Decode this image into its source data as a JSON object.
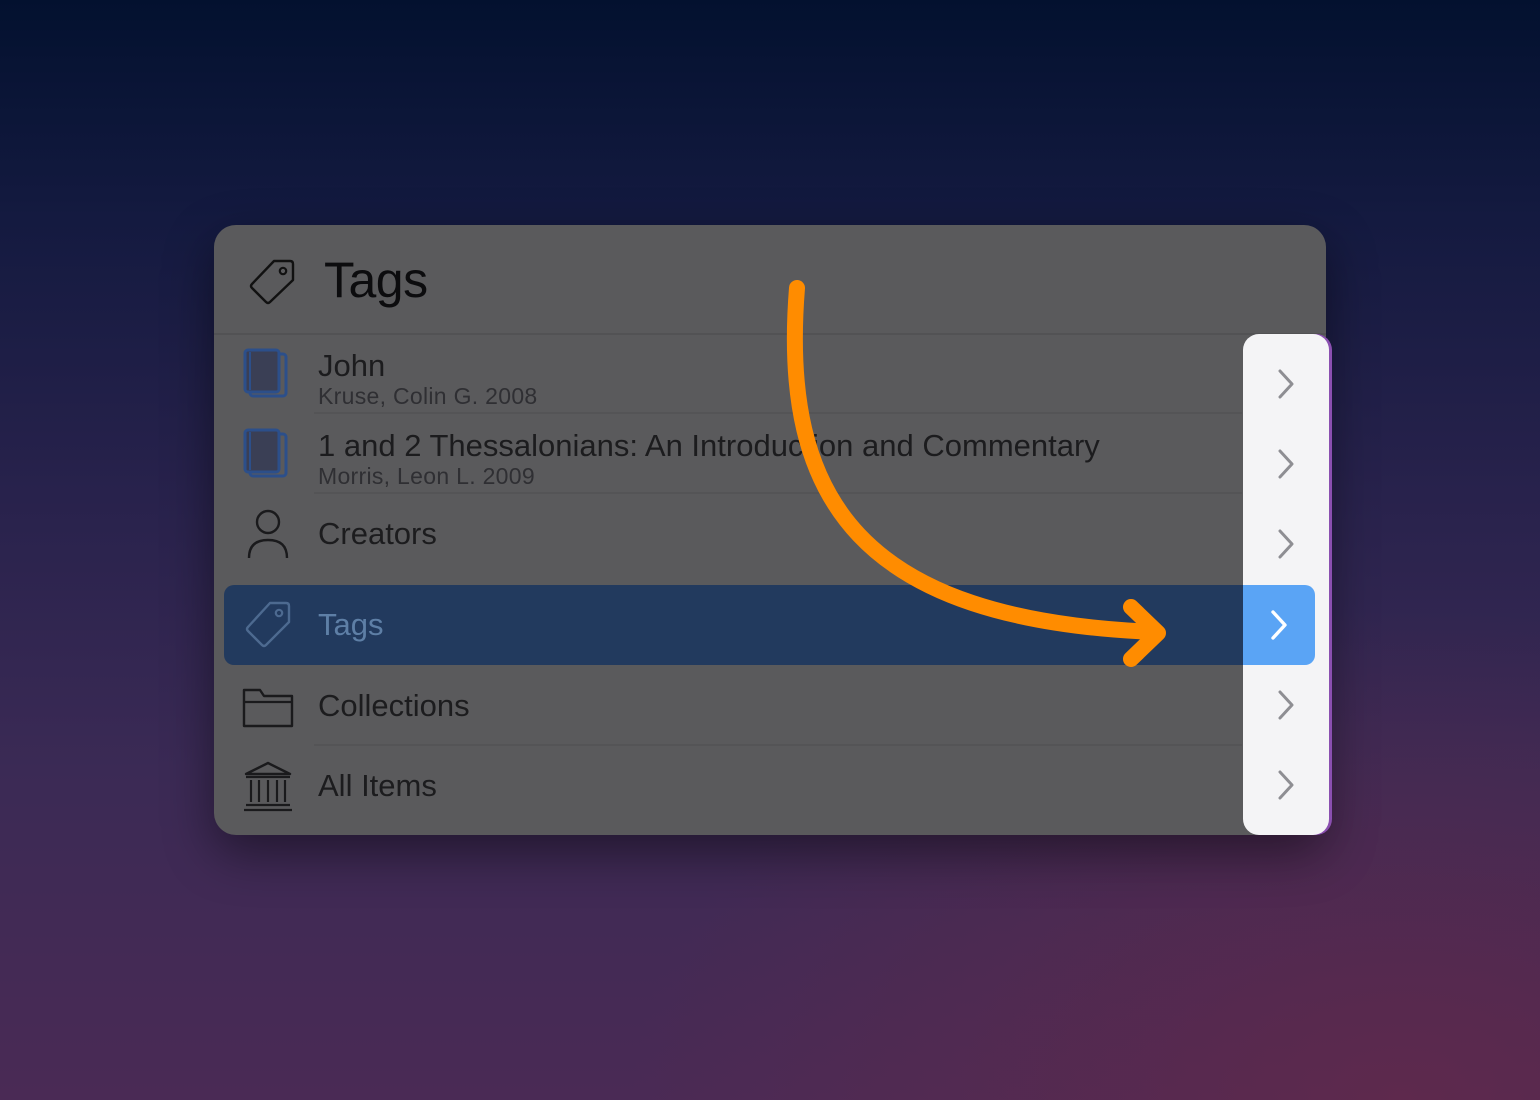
{
  "header": {
    "title": "Tags",
    "icon": "tag-icon"
  },
  "rows": [
    {
      "title": "John",
      "subtitle": "Kruse, Colin G. 2008",
      "icon": "book-icon"
    },
    {
      "title": "1 and 2 Thessalonians: An Introduction and Commentary",
      "subtitle": "Morris, Leon L. 2009",
      "icon": "book-icon"
    },
    {
      "title": "Creators",
      "icon": "person-icon"
    },
    {
      "title": "Tags",
      "icon": "tag-icon",
      "selected": true
    },
    {
      "title": "Collections",
      "icon": "folder-icon"
    },
    {
      "title": "All Items",
      "icon": "library-icon"
    }
  ],
  "colors": {
    "selected_row": "#223a5e",
    "active_chevron": "#5aa4f5",
    "annotation_arrow": "#ff8c00",
    "book_icon": "#2c4f8a"
  }
}
